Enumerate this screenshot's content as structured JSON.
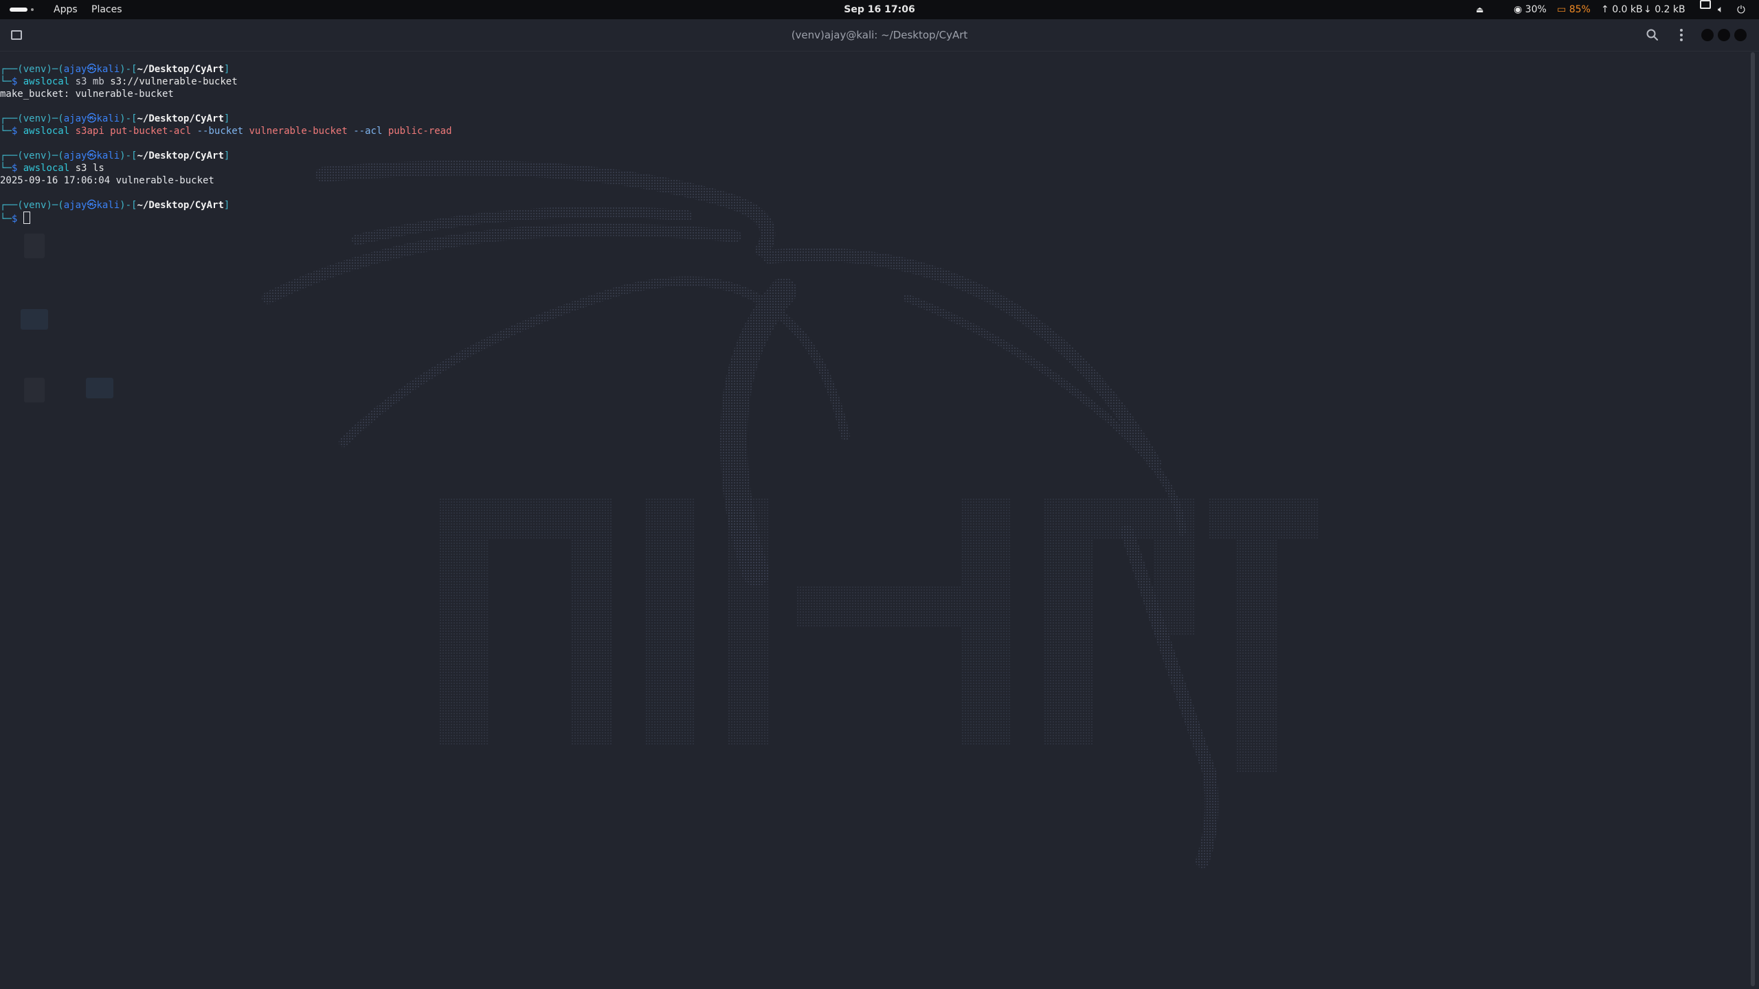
{
  "top_panel": {
    "apps_label": "Apps",
    "places_label": "Places",
    "clock": "Sep 16  17:06",
    "tray": {
      "cpu": "30%",
      "battery": "85%",
      "upload": "0.0 kB",
      "download": "0.2 kB"
    }
  },
  "terminal": {
    "title": "(venv)ajay@kali: ~/Desktop/CyArt",
    "prompt": {
      "venv": "(venv)",
      "user": "ajay",
      "host": "kali",
      "path": "~/Desktop/CyArt",
      "symbol": "$"
    },
    "entries": [
      {
        "command": "awslocal",
        "args": [
          {
            "text": "s3 mb",
            "style": "plain"
          },
          {
            "text": "s3://vulnerable-bucket",
            "style": "white"
          }
        ],
        "output": "make_bucket: vulnerable-bucket"
      },
      {
        "command": "awslocal",
        "args": [
          {
            "text": "s3api put-bucket-acl",
            "style": "arg"
          },
          {
            "text": "--bucket",
            "style": "opt"
          },
          {
            "text": "vulnerable-bucket",
            "style": "arg"
          },
          {
            "text": "--acl",
            "style": "opt"
          },
          {
            "text": "public-read",
            "style": "arg"
          }
        ],
        "output": ""
      },
      {
        "command": "awslocal",
        "args": [
          {
            "text": "s3 ls",
            "style": "white"
          }
        ],
        "output": "2025-09-16 17:06:04 vulnerable-bucket"
      }
    ]
  },
  "colors": {
    "background": "#22252e",
    "panel": "#0d0e11",
    "prompt_blue": "#3b82f6",
    "prompt_cyan": "#3fb5c9",
    "command_cyan": "#34c7d9",
    "arg_red": "#f07a7a",
    "battery_orange": "#f08a24"
  }
}
